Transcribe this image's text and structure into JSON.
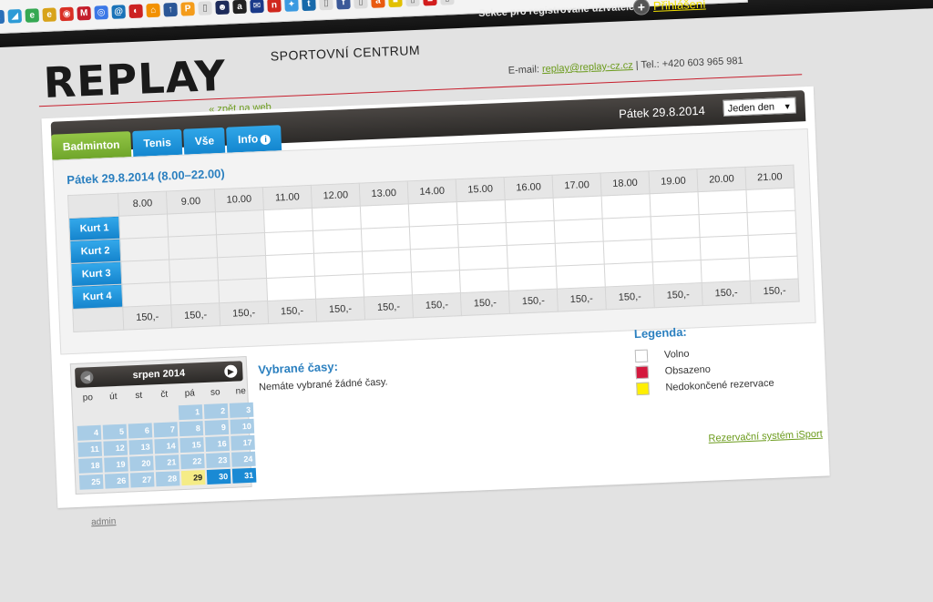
{
  "account": {
    "registered_section": "Sekce pro registrované uživatele",
    "login": "Přihlášení"
  },
  "header": {
    "logo": "REPLAY",
    "subtitle": "SPORTOVNÍ CENTRUM",
    "email_label": "E-mail:",
    "email": "replay@replay-cz.cz",
    "phone": "| Tel.: +420 603 965 981",
    "back_link": "« zpět na web"
  },
  "datebar": {
    "date": "Pátek 29.8.2014",
    "period": "Jeden den"
  },
  "tabs": [
    {
      "label": "Badminton"
    },
    {
      "label": "Tenis"
    },
    {
      "label": "Vše"
    },
    {
      "label": "Info"
    }
  ],
  "schedule": {
    "title": "Pátek 29.8.2014   (8.00–22.00)",
    "hours": [
      "8.00",
      "9.00",
      "10.00",
      "11.00",
      "12.00",
      "13.00",
      "14.00",
      "15.00",
      "16.00",
      "17.00",
      "18.00",
      "19.00",
      "20.00",
      "21.00"
    ],
    "courts": [
      "Kurt 1",
      "Kurt 2",
      "Kurt 3",
      "Kurt 4"
    ],
    "prices": [
      "150,-",
      "150,-",
      "150,-",
      "150,-",
      "150,-",
      "150,-",
      "150,-",
      "150,-",
      "150,-",
      "150,-",
      "150,-",
      "150,-",
      "150,-",
      "150,-"
    ]
  },
  "selected": {
    "title": "Vybrané časy:",
    "message": "Nemáte vybrané žádné časy."
  },
  "legend": {
    "title": "Legenda:",
    "items": [
      {
        "label": "Volno",
        "color": "#ffffff"
      },
      {
        "label": "Obsazeno",
        "color": "#d4183d"
      },
      {
        "label": "Nedokončené rezervace",
        "color": "#ffef00"
      }
    ]
  },
  "calendar": {
    "month": "srpen 2014",
    "weekdays": [
      "po",
      "út",
      "st",
      "čt",
      "pá",
      "so",
      "ne"
    ],
    "today": 29
  },
  "footer": {
    "isport": "Rezervační systém iSport",
    "admin": "admin"
  }
}
